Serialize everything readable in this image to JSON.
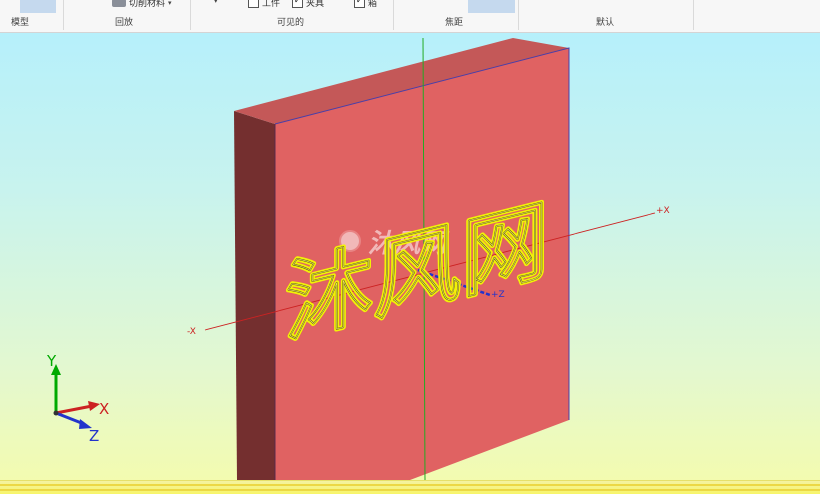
{
  "ribbon": {
    "groups": [
      {
        "label": "模型"
      },
      {
        "label": "回放"
      },
      {
        "label": "可见的"
      },
      {
        "label": "焦距"
      },
      {
        "label": "默认"
      }
    ],
    "controls": {
      "cut_material_label": "切削材料",
      "workpiece_label": "工件",
      "workpiece_checked": false,
      "fixture_label": "夹具",
      "fixture_checked": true,
      "third_checkbox_label": "箱",
      "third_checkbox_checked": true
    }
  },
  "viewport": {
    "engraved_text": "沐风网",
    "watermark_text": "沐风网",
    "axis_labels": {
      "x_pos": "+X",
      "x_neg": "-X",
      "z_pos": "+Z"
    },
    "triad": {
      "x": "X",
      "y": "Y",
      "z": "Z"
    },
    "colors": {
      "block_front": "#e06262",
      "block_top": "#c45858",
      "block_side": "#742f2f",
      "engraving": "#f2f208",
      "x_axis": "#cc2222",
      "y_axis": "#00aa00",
      "z_axis": "#2233cc"
    }
  }
}
